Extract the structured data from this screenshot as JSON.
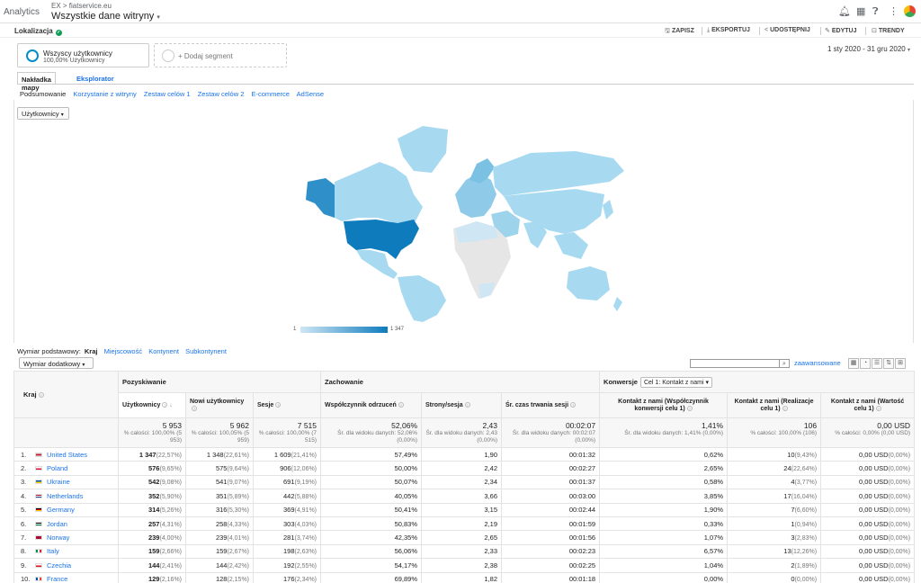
{
  "topbar": {
    "app_name": "Analytics",
    "account_crumb": "EX > fiatservice.eu",
    "view_name": "Wszystkie dane witryny"
  },
  "report": {
    "title": "Lokalizacja",
    "actions": {
      "save": "ZAPISZ",
      "export": "EKSPORTUJ",
      "share": "UDOSTĘPNIJ",
      "edit": "EDYTUJ",
      "insights": "TRENDY"
    }
  },
  "segments": {
    "all_users_name": "Wszyscy użytkownicy",
    "all_users_sub": "100,00% Użytkownicy",
    "add_label": "+ Dodaj segment"
  },
  "date_range": "1 sty 2020 - 31 gru 2020",
  "view_tabs": {
    "map_overlay": "Nakładka mapy",
    "explorer": "Eksplorator"
  },
  "subnav": [
    "Podsumowanie",
    "Korzystanie z witryny",
    "Zestaw celów 1",
    "Zestaw celów 2",
    "E-commerce",
    "AdSense"
  ],
  "map": {
    "metric_selector": "Użytkownicy",
    "legend_min": "1",
    "legend_max": "1 347",
    "colors": {
      "low": "#cfe6f5",
      "mid": "#9ed3ec",
      "high": "#0e7bbd",
      "none": "#e8e8e8"
    }
  },
  "dimension_bar": {
    "label": "Wymiar podstawowy:",
    "current": "Kraj",
    "options": [
      "Miejscowość",
      "Kontynent",
      "Subkontynent"
    ],
    "secondary": "Wymiar dodatkowy",
    "advanced": "zaawansowane"
  },
  "table": {
    "dimension_header": "Kraj",
    "groups": {
      "acquisition": "Pozyskiwanie",
      "behavior": "Zachowanie",
      "conversions": "Konwersje",
      "goal_select": "Cel 1: Kontakt z nami"
    },
    "columns": {
      "users": "Użytkownicy",
      "new_users": "Nowi użytkownicy",
      "sessions": "Sesje",
      "bounce": "Współczynnik odrzuceń",
      "pages_session": "Strony/sesja",
      "avg_duration": "Śr. czas trwania sesji",
      "conv_rate": "Kontakt z nami (Współczynnik konwersji celu 1)",
      "completions": "Kontakt z nami (Realizacje celu 1)",
      "value": "Kontakt z nami (Wartość celu 1)"
    },
    "totals": {
      "users": {
        "value": "5 953",
        "sub": "% całości: 100,00% (5 953)"
      },
      "new_users": {
        "value": "5 962",
        "sub": "% całości: 100,05% (5 959)"
      },
      "sessions": {
        "value": "7 515",
        "sub": "% całości: 100,00% (7 515)"
      },
      "bounce": {
        "value": "52,06%",
        "sub": "Śr. dla widoku danych: 52,06% (0,00%)"
      },
      "pages_session": {
        "value": "2,43",
        "sub": "Śr. dla widoku danych: 2,43 (0,00%)"
      },
      "avg_duration": {
        "value": "00:02:07",
        "sub": "Śr. dla widoku danych: 00:02:07 (0,00%)"
      },
      "conv_rate": {
        "value": "1,41%",
        "sub": "Śr. dla widoku danych: 1,41% (0,00%)"
      },
      "completions": {
        "value": "106",
        "sub": "% całości: 100,00% (106)"
      },
      "value": {
        "value": "0,00 USD",
        "sub": "% całości: 0,00% (0,00 USD)"
      }
    },
    "rows": [
      {
        "rank": "1.",
        "country": "United States",
        "flag": "us",
        "users": "1 347",
        "users_pct": "(22,57%)",
        "new_users": "1 348",
        "new_users_pct": "(22,61%)",
        "sessions": "1 609",
        "sessions_pct": "(21,41%)",
        "bounce": "57,49%",
        "pages": "1,90",
        "duration": "00:01:32",
        "conv": "0,62%",
        "comp": "10",
        "comp_pct": "(9,43%)",
        "val": "0,00 USD",
        "val_pct": "(0,00%)"
      },
      {
        "rank": "2.",
        "country": "Poland",
        "flag": "pl",
        "users": "576",
        "users_pct": "(9,65%)",
        "new_users": "575",
        "new_users_pct": "(9,64%)",
        "sessions": "906",
        "sessions_pct": "(12,06%)",
        "bounce": "50,00%",
        "pages": "2,42",
        "duration": "00:02:27",
        "conv": "2,65%",
        "comp": "24",
        "comp_pct": "(22,64%)",
        "val": "0,00 USD",
        "val_pct": "(0,00%)"
      },
      {
        "rank": "3.",
        "country": "Ukraine",
        "flag": "ua",
        "users": "542",
        "users_pct": "(9,08%)",
        "new_users": "541",
        "new_users_pct": "(9,07%)",
        "sessions": "691",
        "sessions_pct": "(9,19%)",
        "bounce": "50,07%",
        "pages": "2,34",
        "duration": "00:01:37",
        "conv": "0,58%",
        "comp": "4",
        "comp_pct": "(3,77%)",
        "val": "0,00 USD",
        "val_pct": "(0,00%)"
      },
      {
        "rank": "4.",
        "country": "Netherlands",
        "flag": "nl",
        "users": "352",
        "users_pct": "(5,90%)",
        "new_users": "351",
        "new_users_pct": "(5,89%)",
        "sessions": "442",
        "sessions_pct": "(5,88%)",
        "bounce": "40,05%",
        "pages": "3,66",
        "duration": "00:03:00",
        "conv": "3,85%",
        "comp": "17",
        "comp_pct": "(16,04%)",
        "val": "0,00 USD",
        "val_pct": "(0,00%)"
      },
      {
        "rank": "5.",
        "country": "Germany",
        "flag": "de",
        "users": "314",
        "users_pct": "(5,26%)",
        "new_users": "316",
        "new_users_pct": "(5,30%)",
        "sessions": "369",
        "sessions_pct": "(4,91%)",
        "bounce": "50,41%",
        "pages": "3,15",
        "duration": "00:02:44",
        "conv": "1,90%",
        "comp": "7",
        "comp_pct": "(6,60%)",
        "val": "0,00 USD",
        "val_pct": "(0,00%)"
      },
      {
        "rank": "6.",
        "country": "Jordan",
        "flag": "jo",
        "users": "257",
        "users_pct": "(4,31%)",
        "new_users": "258",
        "new_users_pct": "(4,33%)",
        "sessions": "303",
        "sessions_pct": "(4,03%)",
        "bounce": "50,83%",
        "pages": "2,19",
        "duration": "00:01:59",
        "conv": "0,33%",
        "comp": "1",
        "comp_pct": "(0,94%)",
        "val": "0,00 USD",
        "val_pct": "(0,00%)"
      },
      {
        "rank": "7.",
        "country": "Norway",
        "flag": "no",
        "users": "239",
        "users_pct": "(4,00%)",
        "new_users": "239",
        "new_users_pct": "(4,01%)",
        "sessions": "281",
        "sessions_pct": "(3,74%)",
        "bounce": "42,35%",
        "pages": "2,65",
        "duration": "00:01:56",
        "conv": "1,07%",
        "comp": "3",
        "comp_pct": "(2,83%)",
        "val": "0,00 USD",
        "val_pct": "(0,00%)"
      },
      {
        "rank": "8.",
        "country": "Italy",
        "flag": "it",
        "users": "159",
        "users_pct": "(2,66%)",
        "new_users": "159",
        "new_users_pct": "(2,67%)",
        "sessions": "198",
        "sessions_pct": "(2,63%)",
        "bounce": "56,06%",
        "pages": "2,33",
        "duration": "00:02:23",
        "conv": "6,57%",
        "comp": "13",
        "comp_pct": "(12,26%)",
        "val": "0,00 USD",
        "val_pct": "(0,00%)"
      },
      {
        "rank": "9.",
        "country": "Czechia",
        "flag": "cz",
        "users": "144",
        "users_pct": "(2,41%)",
        "new_users": "144",
        "new_users_pct": "(2,42%)",
        "sessions": "192",
        "sessions_pct": "(2,55%)",
        "bounce": "54,17%",
        "pages": "2,38",
        "duration": "00:02:25",
        "conv": "1,04%",
        "comp": "2",
        "comp_pct": "(1,89%)",
        "val": "0,00 USD",
        "val_pct": "(0,00%)"
      },
      {
        "rank": "10.",
        "country": "France",
        "flag": "fr",
        "users": "129",
        "users_pct": "(2,16%)",
        "new_users": "128",
        "new_users_pct": "(2,15%)",
        "sessions": "176",
        "sessions_pct": "(2,34%)",
        "bounce": "69,89%",
        "pages": "1,82",
        "duration": "00:01:18",
        "conv": "0,00%",
        "comp": "0",
        "comp_pct": "(0,00%)",
        "val": "0,00 USD",
        "val_pct": "(0,00%)"
      }
    ]
  }
}
